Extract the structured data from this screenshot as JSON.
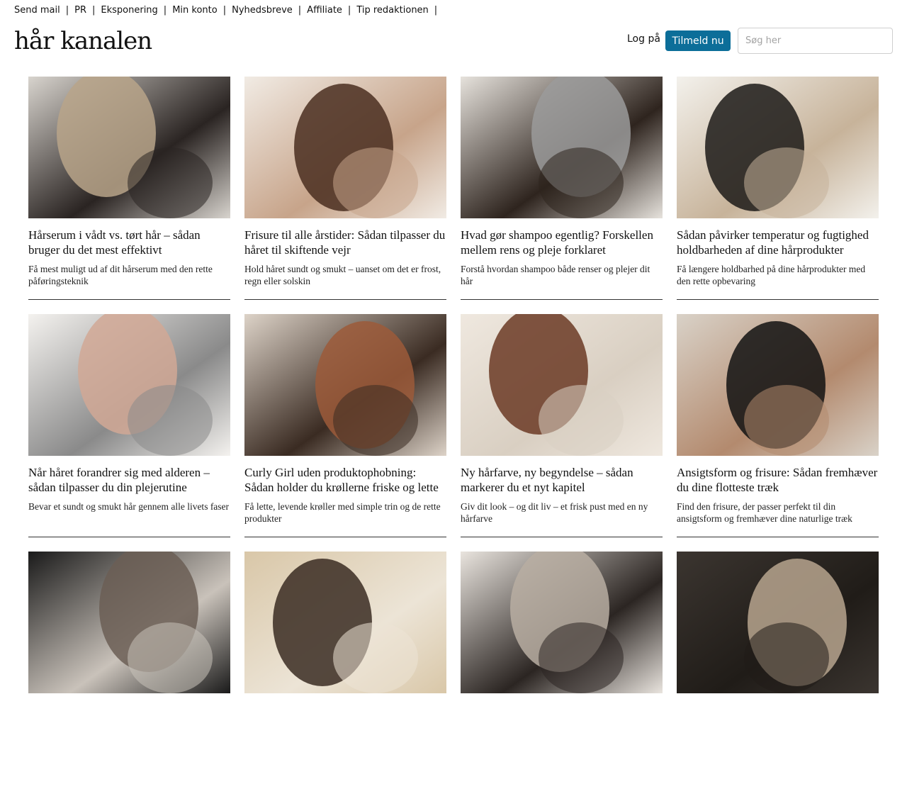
{
  "topnav": [
    "Send mail",
    "PR",
    "Eksponering",
    "Min konto",
    "Nyhedsbreve",
    "Affiliate",
    "Tip redaktionen"
  ],
  "logo": "hår kanalen",
  "header": {
    "login": "Log på",
    "signup": "Tilmeld nu",
    "search_placeholder": "Søg her"
  },
  "colors": {
    "accent": "#0c6e99"
  },
  "articles": [
    {
      "title": "Hårserum i vådt vs. tørt hår – sådan bruger du det mest effektivt",
      "desc": "Få mest muligt ud af dit hårserum med den rette påføringsteknik",
      "image": "salon-mirror-spray-photo",
      "tones": [
        "#d8d4ce",
        "#b9a58a",
        "#2a2422"
      ]
    },
    {
      "title": "Frisure til alle årstider: Sådan tilpasser du håret til skiftende vejr",
      "desc": "Hold håret sundt og smukt – uanset om det er frost, regn eller solskin",
      "image": "hair-cutting-scissors-photo",
      "tones": [
        "#f1ebe4",
        "#4a2e20",
        "#c7a48a"
      ]
    },
    {
      "title": "Hvad gør shampoo egentlig? Forskellen mellem rens og pleje forklaret",
      "desc": "Forstå hvordan shampoo både renser og plejer dit hår",
      "image": "foil-highlights-photo",
      "tones": [
        "#e6e2dc",
        "#9b9b9b",
        "#2e241e"
      ]
    },
    {
      "title": "Sådan påvirker temperatur og fugtighed holdbarheden af dine hårprodukter",
      "desc": "Få længere holdbarhed på dine hårprodukter med den rette opbevaring",
      "image": "barber-cut-photo",
      "tones": [
        "#f3f1ec",
        "#1c1a18",
        "#c7b39a"
      ]
    },
    {
      "title": "Når håret forandrer sig med alderen – sådan tilpasser du din plejerutine",
      "desc": "Bevar et sundt og smukt hår gennem alle livets faser",
      "image": "man-trimming-beard-photo",
      "tones": [
        "#f4f2ef",
        "#d1a895",
        "#8a8a8a"
      ]
    },
    {
      "title": "Curly Girl uden produktophobning: Sådan holder du krøllerne friske og lette",
      "desc": "Få lette, levende krøller med simple trin og de rette produkter",
      "image": "curling-iron-photo",
      "tones": [
        "#ddd3c8",
        "#9c5b3a",
        "#3a2b22"
      ]
    },
    {
      "title": "Ny hårfarve, ny begyndelse – sådan markerer du et nyt kapitel",
      "desc": "Giv dit look – og dit liv – et frisk pust med en ny hårfarve",
      "image": "hair-coloring-foil-photo",
      "tones": [
        "#efe8df",
        "#6b3a24",
        "#d9cfc2"
      ]
    },
    {
      "title": "Ansigtsform og frisure: Sådan fremhæver du dine flotteste træk",
      "desc": "Find den frisure, der passer perfekt til din ansigtsform og fremhæver dine naturlige træk",
      "image": "salon-haircut-photo",
      "tones": [
        "#d9d2c8",
        "#121212",
        "#b38a6e"
      ]
    },
    {
      "title": "",
      "desc": "",
      "image": "partial-photo-1",
      "tones": [
        "#1a1a1a",
        "#6b5e55",
        "#c9c2ba"
      ]
    },
    {
      "title": "",
      "desc": "",
      "image": "partial-photo-2",
      "tones": [
        "#d9c7a8",
        "#3a2c22",
        "#ece4d6"
      ]
    },
    {
      "title": "",
      "desc": "",
      "image": "partial-photo-3",
      "tones": [
        "#e9e4de",
        "#b9aea2",
        "#2b2522"
      ]
    },
    {
      "title": "",
      "desc": "",
      "image": "partial-photo-4",
      "tones": [
        "#3b3530",
        "#b7a48e",
        "#201c18"
      ]
    }
  ]
}
